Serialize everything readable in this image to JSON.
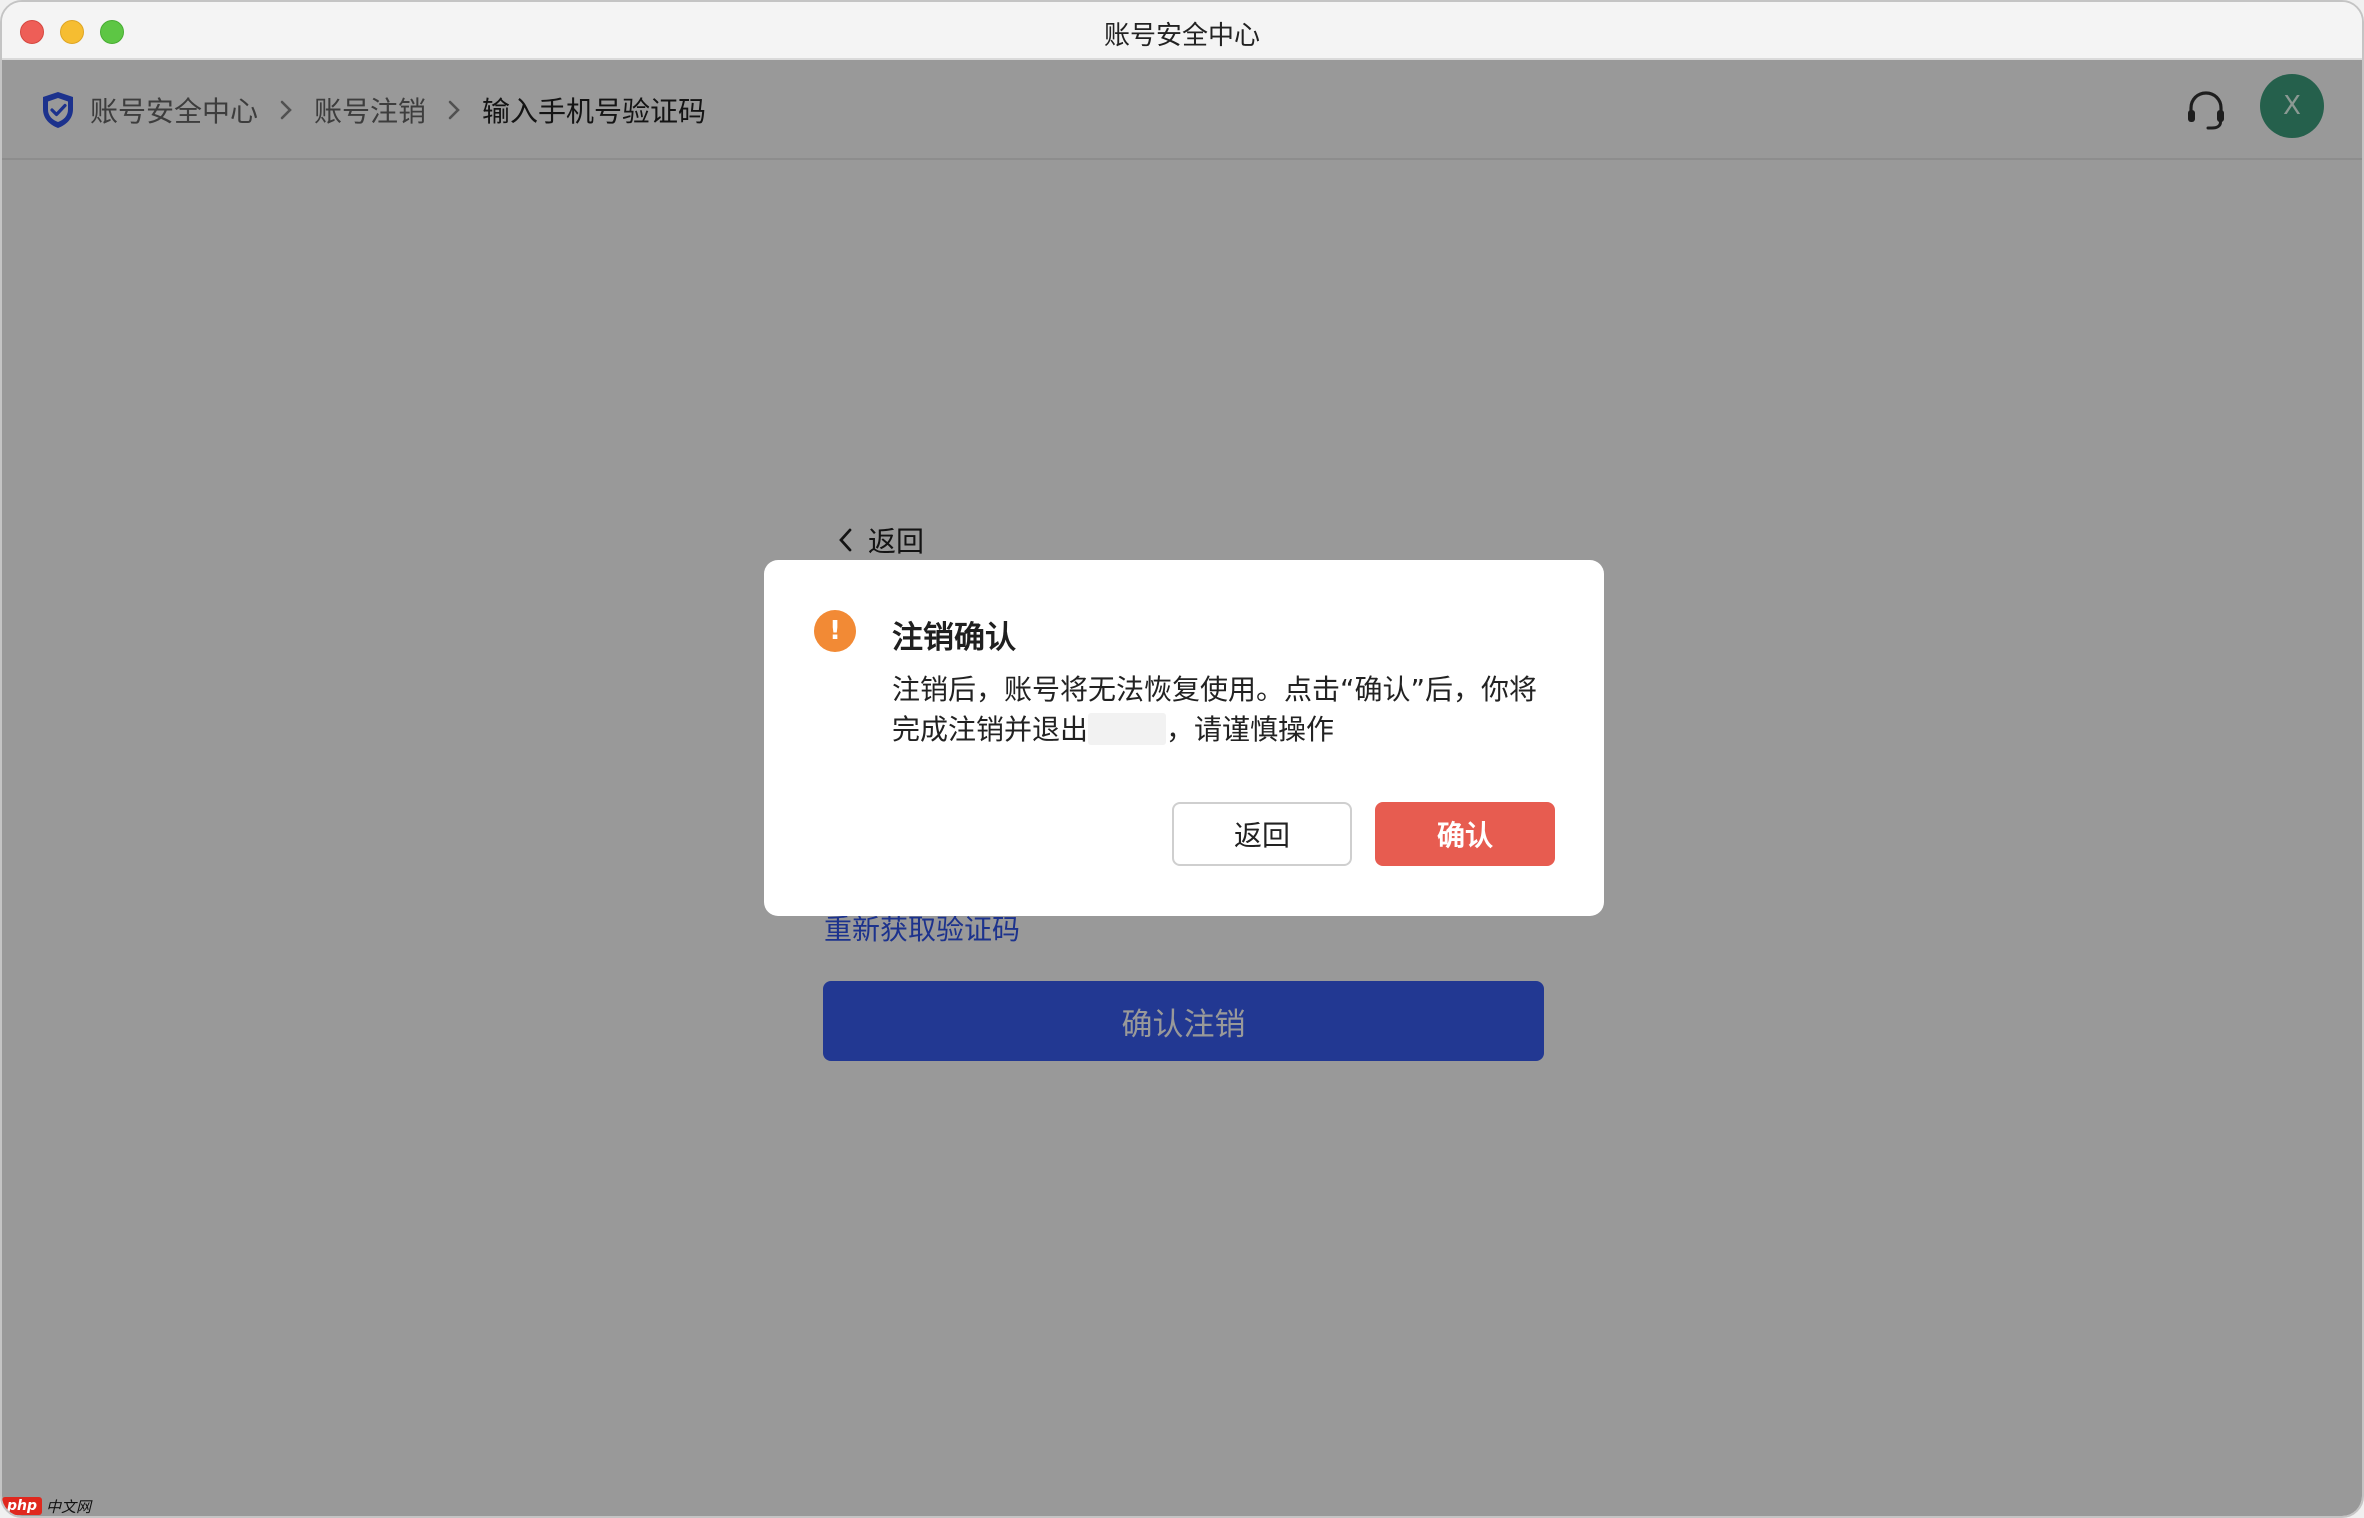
{
  "window": {
    "title": "账号安全中心"
  },
  "header": {
    "breadcrumb": [
      "账号安全中心",
      "账号注销",
      "输入手机号验证码"
    ],
    "avatar_initial": "X",
    "icons": {
      "shield": "shield-icon",
      "support": "headset-icon"
    }
  },
  "page": {
    "back_label": "返回",
    "resend_label": "重新获取验证码",
    "confirm_button_label": "确认注销"
  },
  "dialog": {
    "title": "注销确认",
    "body_line1": "注销后，账号将无法恢复使用。点击“确认”后，你将",
    "body_line2_before": "完成注销并退出",
    "body_line2_after": "，请谨慎操作",
    "cancel_label": "返回",
    "confirm_label": "确认"
  },
  "watermark": {
    "logo": "php",
    "text": "中文网"
  },
  "colors": {
    "primary": "#3a5ef4",
    "danger": "#e75c50",
    "warning": "#f28a35",
    "avatar": "#3ea17f",
    "link": "#2f54eb"
  }
}
